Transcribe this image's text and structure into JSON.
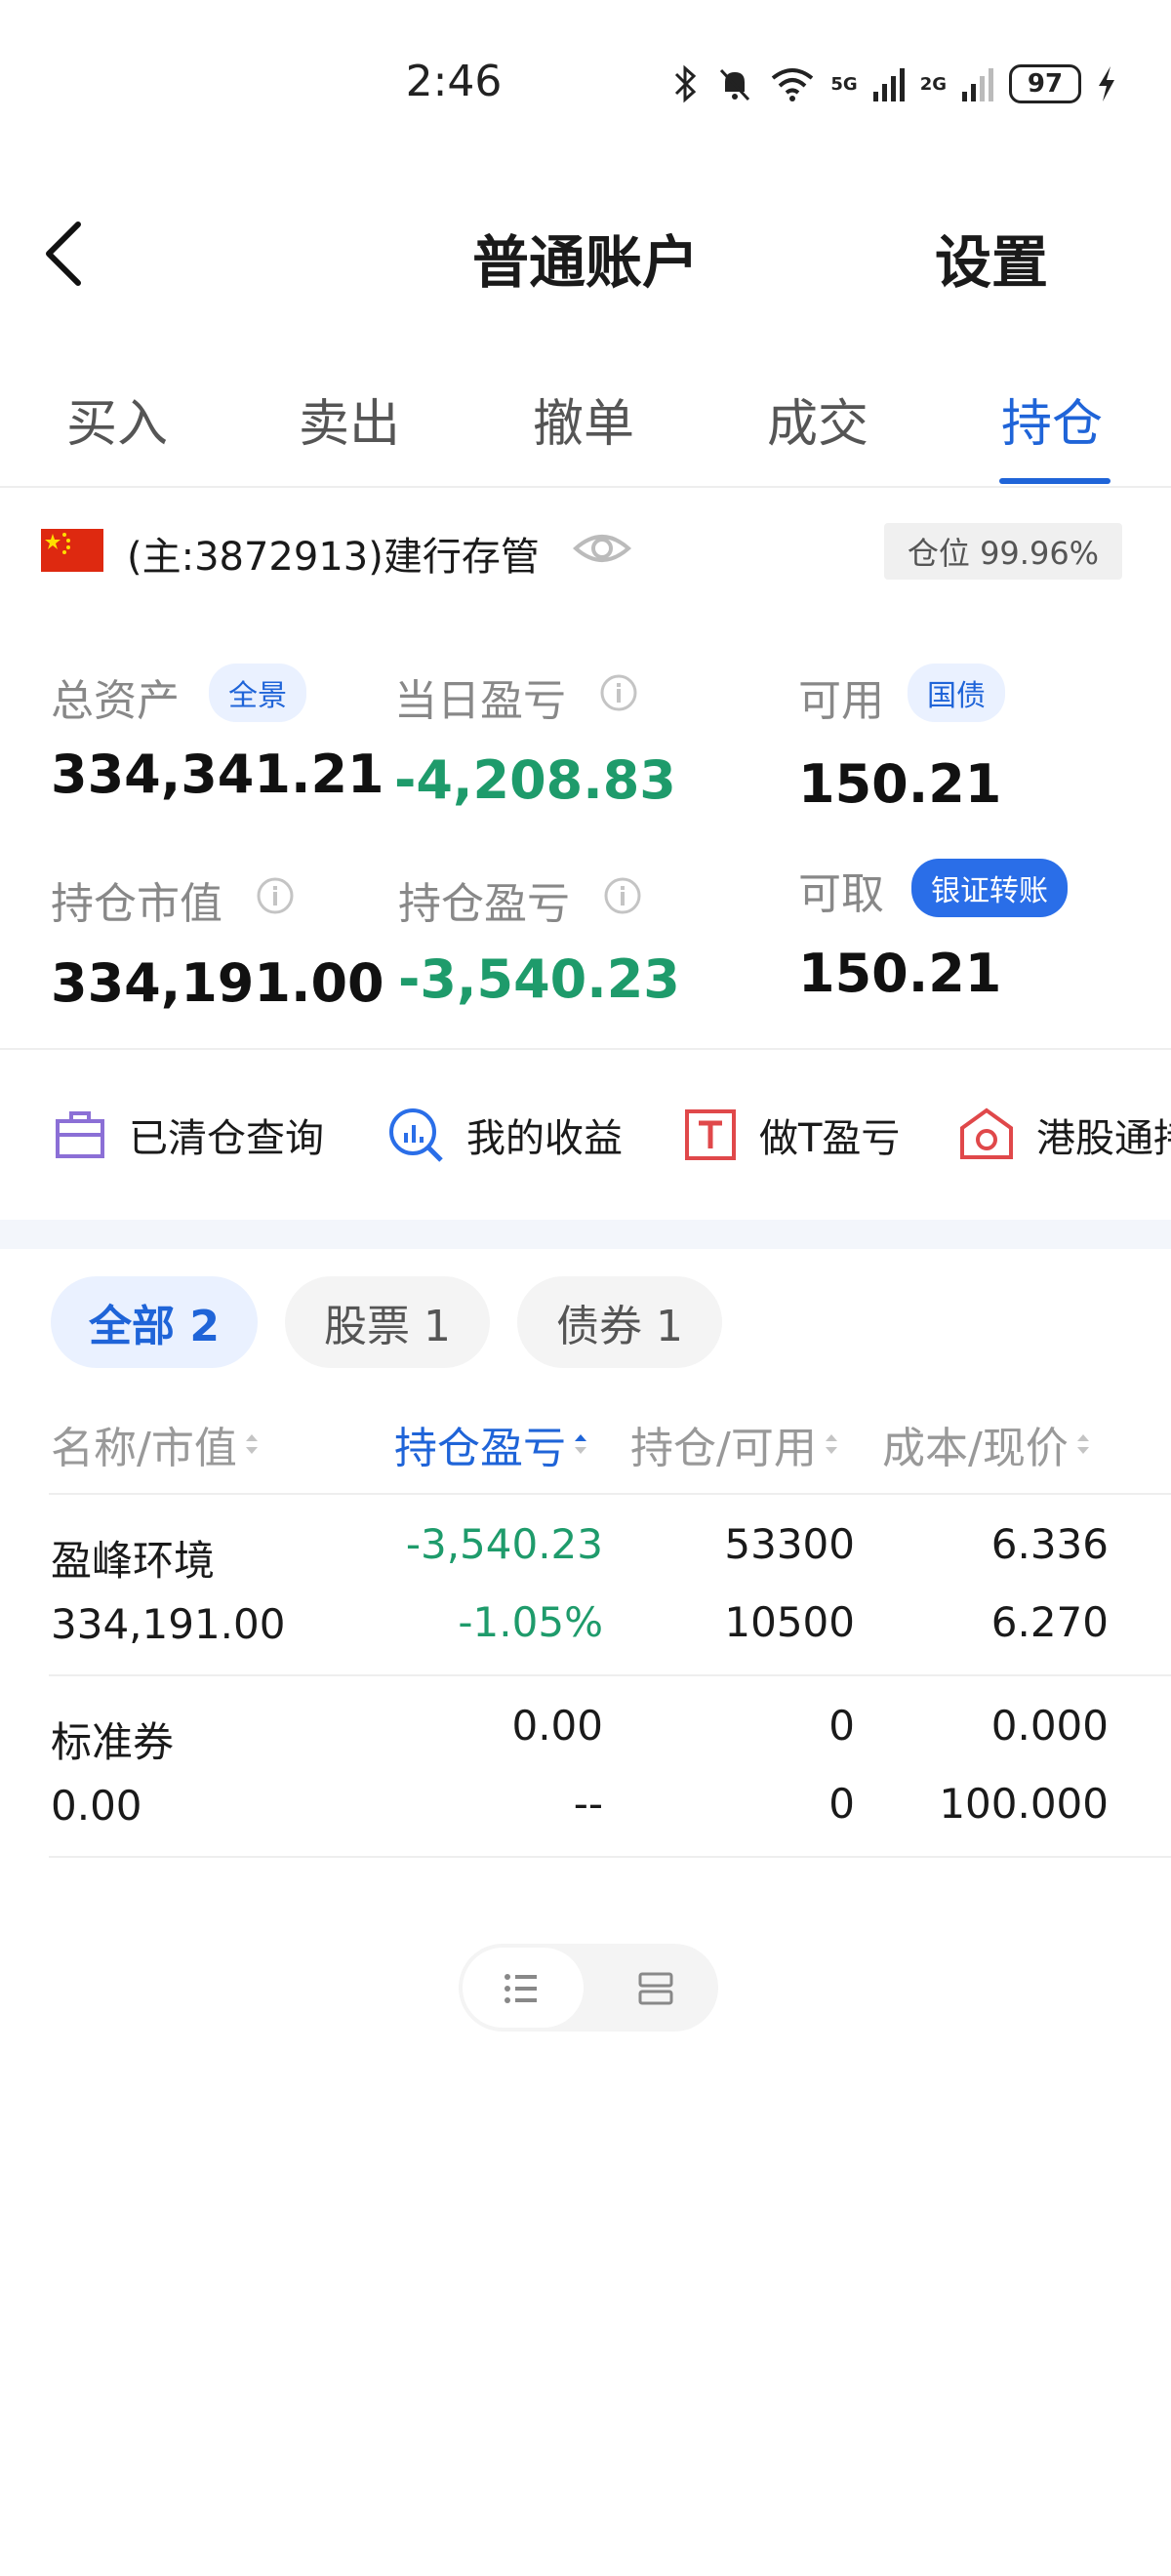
{
  "status": {
    "time": "2:46",
    "battery": "97",
    "net1": "5G",
    "net2": "2G"
  },
  "nav": {
    "title": "普通账户",
    "settings": "设置"
  },
  "tabs": [
    {
      "label": "买入"
    },
    {
      "label": "卖出"
    },
    {
      "label": "撤单"
    },
    {
      "label": "成交"
    },
    {
      "label": "持仓"
    }
  ],
  "account": {
    "label": "(主:3872913)建行存管",
    "position": "仓位 99.96%"
  },
  "stats": {
    "total_assets": {
      "label": "总资产",
      "tag": "全景",
      "value": "334,341.21"
    },
    "daily_pl": {
      "label": "当日盈亏",
      "value": "-4,208.83"
    },
    "available": {
      "label": "可用",
      "tag": "国债",
      "value": "150.21"
    },
    "market_value": {
      "label": "持仓市值",
      "value": "334,191.00"
    },
    "position_pl": {
      "label": "持仓盈亏",
      "value": "-3,540.23"
    },
    "withdrawable": {
      "label": "可取",
      "tag": "银证转账",
      "value": "150.21"
    }
  },
  "shortcuts": {
    "cleared": "已清仓查询",
    "earnings": "我的收益",
    "t_trade": "做T盈亏",
    "hk_connect": "港股通持"
  },
  "filters": {
    "all": "全部 2",
    "stocks": "股票 1",
    "bonds": "债券 1"
  },
  "table": {
    "headers": [
      "名称/市值",
      "持仓盈亏",
      "持仓/可用",
      "成本/现价"
    ],
    "rows": [
      {
        "name": "盈峰环境",
        "value": "334,191.00",
        "pl": "-3,540.23",
        "pl_pct": "-1.05%",
        "hold": "53300",
        "avail": "10500",
        "cost": "6.336",
        "price": "6.270"
      },
      {
        "name": "标准券",
        "value": "0.00",
        "pl": "0.00",
        "pl_pct": "--",
        "hold": "0",
        "avail": "0",
        "cost": "0.000",
        "price": "100.000"
      }
    ]
  },
  "colors": {
    "accent": "#1f64d8",
    "loss_green": "#1e9b6b",
    "muted": "#888888"
  }
}
